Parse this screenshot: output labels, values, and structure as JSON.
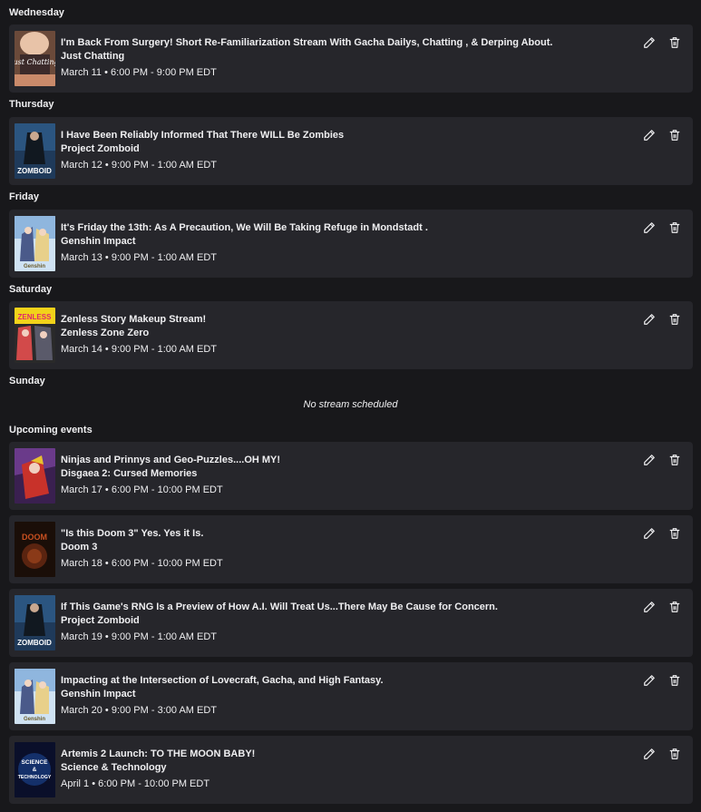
{
  "sections": {
    "wednesday": "Wednesday",
    "thursday": "Thursday",
    "friday": "Friday",
    "saturday": "Saturday",
    "sunday": "Sunday",
    "upcoming": "Upcoming events"
  },
  "no_stream": "No stream scheduled",
  "streams": [
    {
      "title": "I'm Back From Surgery! Short Re-Familiarization Stream With Gacha Dailys, Chatting , & Derping About.",
      "game": "Just Chatting",
      "date": "March 11",
      "time": "6:00 PM - 9:00 PM EDT",
      "thumb_icon": "just-chatting-thumbnail"
    },
    {
      "title": "I Have Been Reliably Informed That There WILL Be Zombies",
      "game": "Project Zomboid",
      "date": "March 12",
      "time": "9:00 PM - 1:00 AM EDT",
      "thumb_icon": "project-zomboid-thumbnail"
    },
    {
      "title": "It's Friday the 13th: As A Precaution, We Will Be Taking Refuge in Mondstadt .",
      "game": "Genshin Impact",
      "date": "March 13",
      "time": "9:00 PM - 1:00 AM EDT",
      "thumb_icon": "genshin-impact-thumbnail"
    },
    {
      "title": "Zenless Story Makeup Stream!",
      "game": "Zenless Zone Zero",
      "date": "March 14",
      "time": "9:00 PM - 1:00 AM EDT",
      "thumb_icon": "zenless-zone-zero-thumbnail"
    },
    {
      "title": "Ninjas and Prinnys and Geo-Puzzles....OH MY!",
      "game": "Disgaea 2: Cursed Memories",
      "date": "March 17",
      "time": "6:00 PM - 10:00 PM EDT",
      "thumb_icon": "disgaea-2-thumbnail"
    },
    {
      "title": "\"Is this Doom 3\" Yes. Yes it Is.",
      "game": "Doom 3",
      "date": "March 18",
      "time": "6:00 PM - 10:00 PM EDT",
      "thumb_icon": "doom-3-thumbnail"
    },
    {
      "title": "If This Game's RNG Is a Preview of How A.I. Will Treat Us...There May Be Cause for Concern.",
      "game": "Project Zomboid",
      "date": "March 19",
      "time": "9:00 PM - 1:00 AM EDT",
      "thumb_icon": "project-zomboid-thumbnail"
    },
    {
      "title": "Impacting at the Intersection of Lovecraft, Gacha, and High Fantasy.",
      "game": "Genshin Impact",
      "date": "March 20",
      "time": "9:00 PM - 3:00 AM EDT",
      "thumb_icon": "genshin-impact-thumbnail"
    },
    {
      "title": "Artemis 2 Launch: TO THE MOON BABY!",
      "game": "Science & Technology",
      "date": "April 1",
      "time": "6:00 PM - 10:00 PM EDT",
      "thumb_icon": "science-technology-thumbnail"
    }
  ],
  "separator": "•",
  "thumb_text": {
    "just_chatting": "Just Chatting",
    "zomboid": "ZOMBOID",
    "genshin": "Genshin",
    "zenless": "ZENLESS",
    "doom": "DOOM",
    "science": "SCIENCE",
    "and": "&",
    "technology": "TECHNOLOGY"
  },
  "colors": {
    "background": "#18181b",
    "card": "#26262b",
    "text": "#efeff1"
  }
}
